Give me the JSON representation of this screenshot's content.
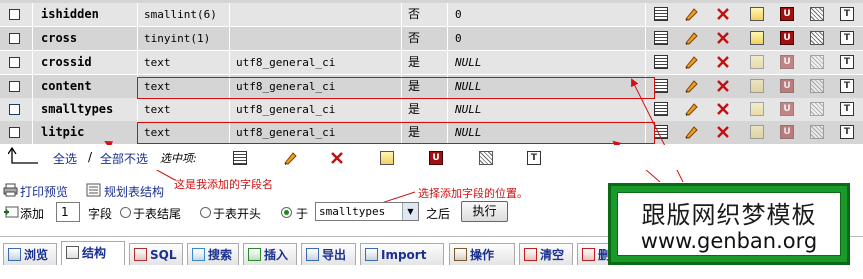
{
  "fields": [
    {
      "name": "ishidden",
      "type": "smallint(6)",
      "collation": "",
      "null": "否",
      "default": "0",
      "default_italic": false
    },
    {
      "name": "cross",
      "type": "tinyint(1)",
      "collation": "",
      "null": "否",
      "default": "0",
      "default_italic": false
    },
    {
      "name": "crossid",
      "type": "text",
      "collation": "utf8_general_ci",
      "null": "是",
      "default": "NULL",
      "default_italic": true
    },
    {
      "name": "content",
      "type": "text",
      "collation": "utf8_general_ci",
      "null": "是",
      "default": "NULL",
      "default_italic": true
    },
    {
      "name": "smalltypes",
      "type": "text",
      "collation": "utf8_general_ci",
      "null": "是",
      "default": "NULL",
      "default_italic": true
    },
    {
      "name": "litpic",
      "type": "text",
      "collation": "utf8_general_ci",
      "null": "是",
      "default": "NULL",
      "default_italic": true
    }
  ],
  "check_all": {
    "select_all": "全选",
    "separator": "/",
    "deselect_all": "全部不选",
    "with_selected": "选中项:"
  },
  "annotations": {
    "added_fields": "这是我添加的字段名",
    "choose_position": "选择添加字段的位置。"
  },
  "print_row": {
    "print_view": "打印预览",
    "relation_view": "规划表结构"
  },
  "add_field": {
    "add_label": "添加",
    "count_value": "1",
    "fields_label": "字段",
    "at_end": "于表结尾",
    "at_start": "于表开头",
    "after_label": "于",
    "after_selected": "smalltypes",
    "after_suffix": "之后",
    "go_button": "执行"
  },
  "tabs": [
    {
      "label": "浏览",
      "icon": "browse-icon"
    },
    {
      "label": "结构",
      "icon": "structure-icon",
      "active": true
    },
    {
      "label": "SQL",
      "icon": "sql-icon"
    },
    {
      "label": "搜索",
      "icon": "search-icon"
    },
    {
      "label": "插入",
      "icon": "insert-icon"
    },
    {
      "label": "导出",
      "icon": "export-icon"
    },
    {
      "label": "Import",
      "icon": "import-icon"
    },
    {
      "label": "操作",
      "icon": "operations-icon"
    },
    {
      "label": "清空",
      "icon": "empty-icon"
    },
    {
      "label": "删除",
      "icon": "drop-icon"
    }
  ],
  "watermark": {
    "line1": "跟版网织梦模板",
    "line2": "www.genban.org"
  },
  "colors": {
    "row_light": "#e5e5e5",
    "row_dark": "#d5d5d5",
    "highlight": "#d01010",
    "watermark_green": "#1a9a2a"
  }
}
